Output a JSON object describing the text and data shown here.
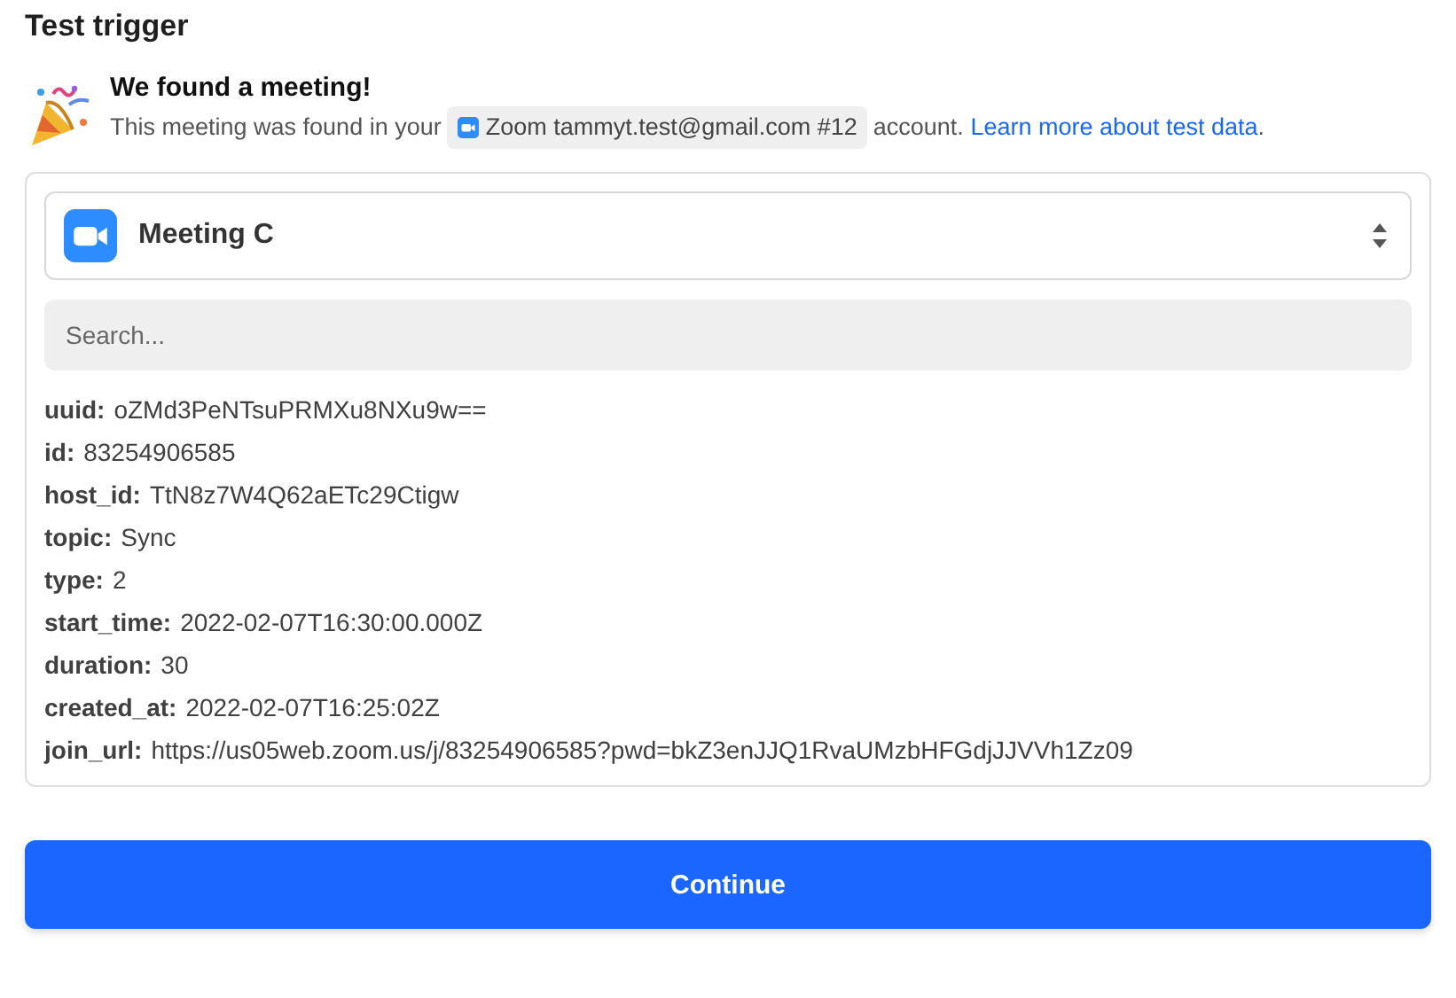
{
  "title": "Test trigger",
  "notice": {
    "heading": "We found a meeting!",
    "text_before": "This meeting was found in your",
    "account": "Zoom tammyt.test@gmail.com #12",
    "text_after": "account.",
    "link": "Learn more about test data",
    "text_end": "."
  },
  "selector": {
    "value": "Meeting C"
  },
  "search": {
    "placeholder": "Search..."
  },
  "fields": [
    {
      "key": "uuid:",
      "value": "oZMd3PeNTsuPRMXu8NXu9w=="
    },
    {
      "key": "id:",
      "value": "83254906585"
    },
    {
      "key": "host_id:",
      "value": "TtN8z7W4Q62aETc29Ctigw"
    },
    {
      "key": "topic:",
      "value": "Sync"
    },
    {
      "key": "type:",
      "value": "2"
    },
    {
      "key": "start_time:",
      "value": "2022-02-07T16:30:00.000Z"
    },
    {
      "key": "duration:",
      "value": "30"
    },
    {
      "key": "created_at:",
      "value": "2022-02-07T16:25:02Z"
    },
    {
      "key": "join_url:",
      "value": "https://us05web.zoom.us/j/83254906585?pwd=bkZ3enJJQ1RvaUMzbHFGdjJJVVh1Zz09"
    }
  ],
  "button": "Continue"
}
